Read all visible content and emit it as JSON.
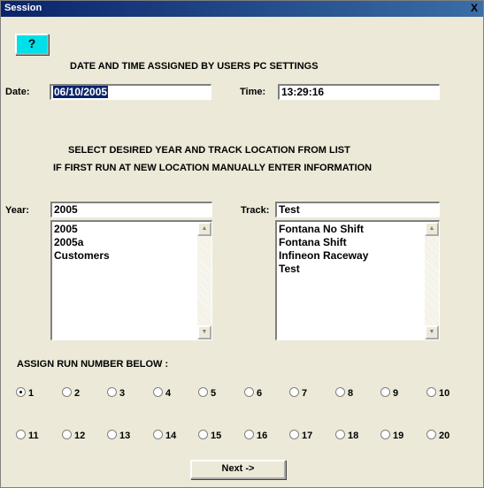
{
  "window": {
    "title": "Session",
    "close_glyph": "X"
  },
  "help_button": {
    "glyph": "?",
    "icon": "question-mark-icon"
  },
  "date_time_notice": "DATE AND TIME  ASSIGNED BY USERS PC SETTINGS",
  "date": {
    "label": "Date:",
    "value": "06/10/2005"
  },
  "time": {
    "label": "Time:",
    "value": "13:29:16"
  },
  "instructions": {
    "line1": "SELECT DESIRED YEAR AND TRACK LOCATION FROM LIST",
    "line2": "IF FIRST RUN AT NEW LOCATION MANUALLY ENTER INFORMATION"
  },
  "year": {
    "label": "Year:",
    "value": "2005",
    "list": [
      "2005",
      "2005a",
      "Customers"
    ]
  },
  "track": {
    "label": "Track:",
    "value": "Test",
    "list": [
      "Fontana No Shift",
      "Fontana Shift",
      "Infineon Raceway",
      "Test"
    ]
  },
  "run_number": {
    "heading": "ASSIGN RUN NUMBER BELOW :",
    "selected": "1",
    "options_row1": [
      "1",
      "2",
      "3",
      "4",
      "5",
      "6",
      "7",
      "8",
      "9",
      "10"
    ],
    "options_row2": [
      "11",
      "12",
      "13",
      "14",
      "15",
      "16",
      "17",
      "18",
      "19",
      "20"
    ]
  },
  "next_button": {
    "label": "Next ->"
  },
  "colors": {
    "title_bar": "#0a246a",
    "help_button": "#00e0e8",
    "selection": "#0a246a",
    "window_bg": "#ece9d8"
  }
}
